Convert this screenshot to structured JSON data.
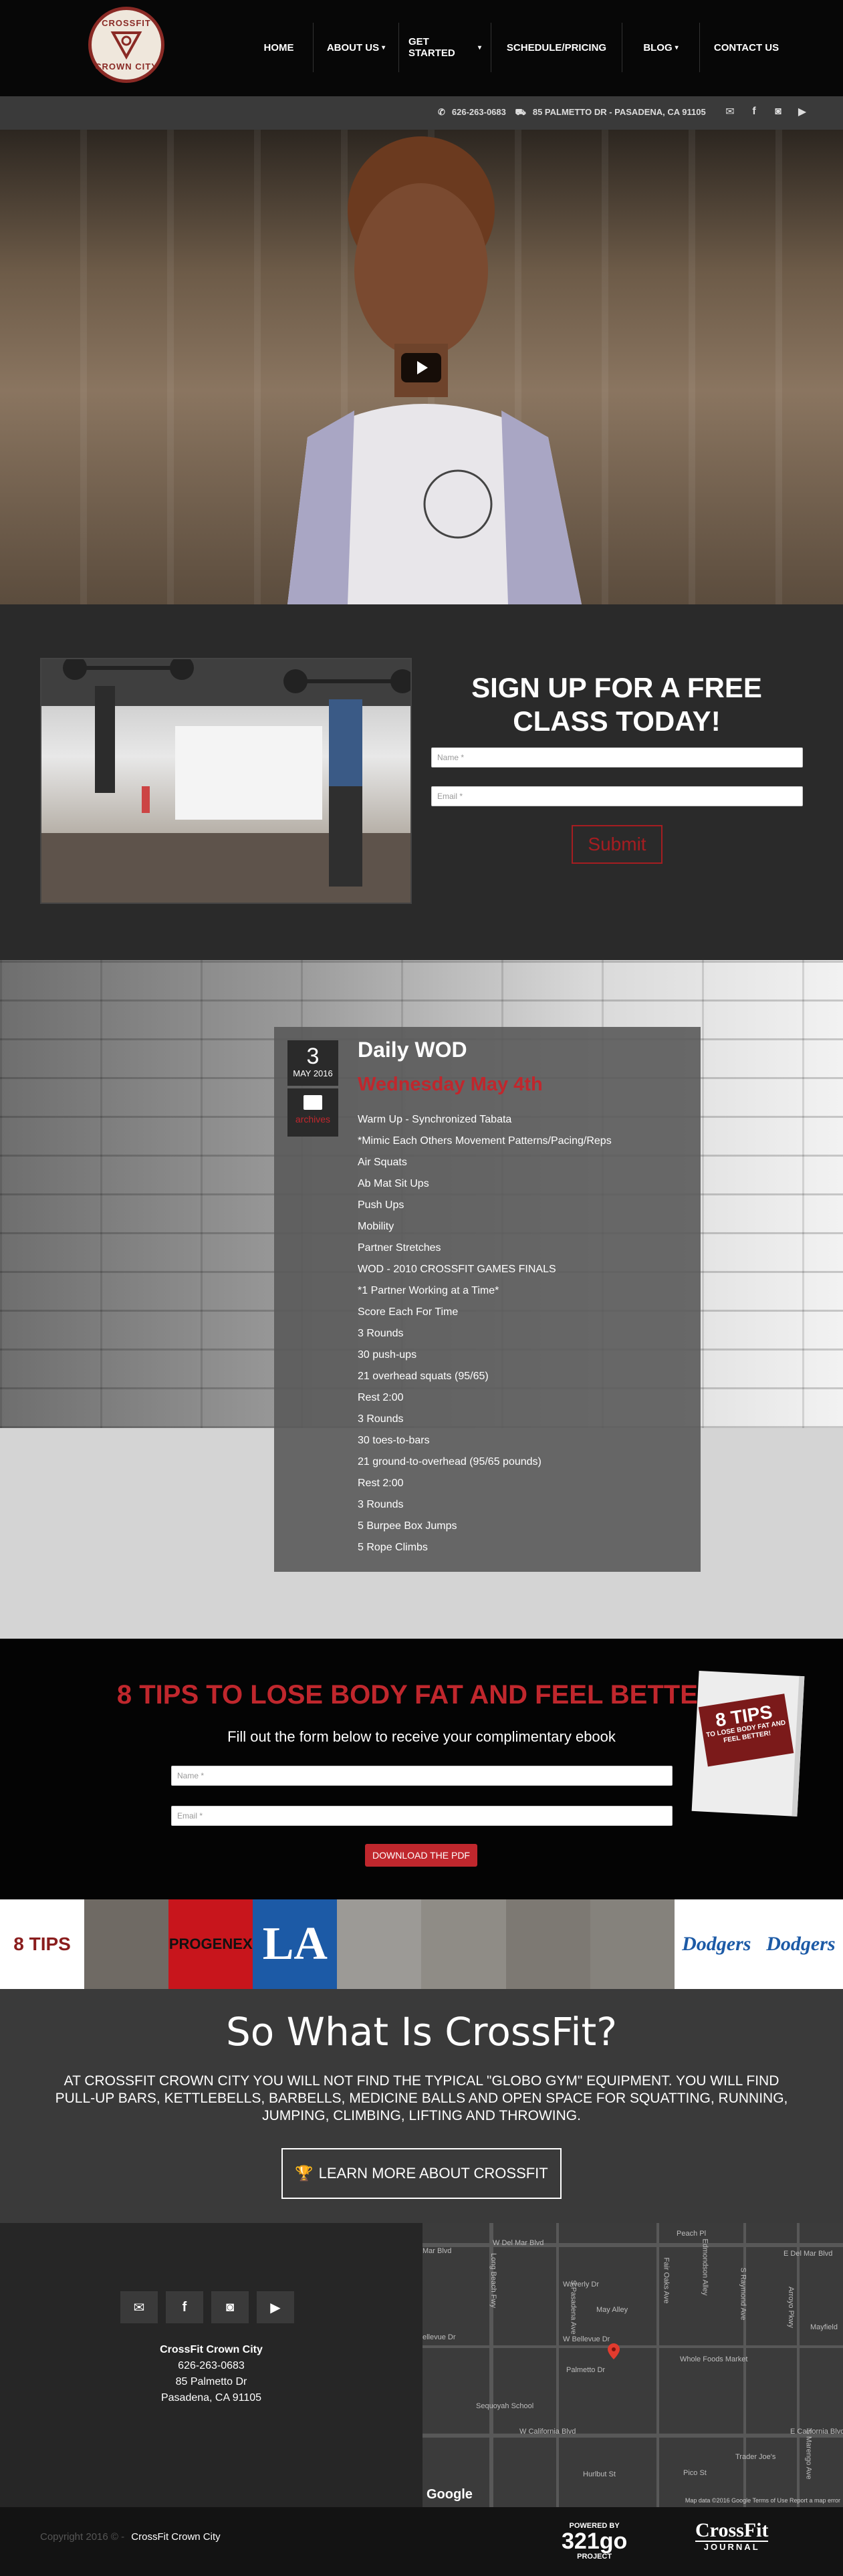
{
  "header": {
    "logo_top": "CROSSFIT",
    "logo_bottom": "CROWN CITY",
    "nav": [
      {
        "label": "HOME",
        "caret": ""
      },
      {
        "label": "ABOUT US",
        "caret": "▾"
      },
      {
        "label": "GET STARTED",
        "caret": "▾"
      },
      {
        "label": "SCHEDULE/PRICING",
        "caret": ""
      },
      {
        "label": "BLOG",
        "caret": "▾"
      },
      {
        "label": "CONTACT US",
        "caret": ""
      }
    ]
  },
  "infobar": {
    "phone": "626-263-0683",
    "address": "85 PALMETTO DR - PASADENA, CA 91105",
    "social": [
      "mail-icon",
      "facebook-icon",
      "instagram-icon",
      "youtube-icon"
    ]
  },
  "signup": {
    "title": "SIGN UP FOR A FREE CLASS TODAY!",
    "name_placeholder": "Name *",
    "email_placeholder": "Email *",
    "submit_label": "Submit"
  },
  "wod": {
    "day": "3",
    "month": "MAY 2016",
    "archive_label": "archives",
    "title": "Daily WOD",
    "subtitle": "Wednesday May 4th",
    "lines": [
      "Warm Up - Synchronized Tabata",
      "*Mimic Each Others Movement Patterns/Pacing/Reps",
      "Air Squats",
      "Ab Mat Sit Ups",
      "Push Ups",
      "Mobility",
      "Partner Stretches",
      "WOD - 2010 CROSSFIT GAMES FINALS",
      "*1 Partner Working at a Time*",
      "Score Each For Time",
      "3 Rounds",
      "30 push-ups",
      "21 overhead squats (95/65)",
      "Rest 2:00",
      "3 Rounds",
      "30 toes-to-bars",
      "21 ground-to-overhead (95/65 pounds)",
      "Rest 2:00",
      "3 Rounds",
      "5 Burpee Box Jumps",
      "5 Rope Climbs"
    ]
  },
  "tips": {
    "title": "8 TIPS TO LOSE BODY FAT AND FEEL BETTER!",
    "subtitle": "Fill out the form below to receive your complimentary ebook",
    "name_placeholder": "Name *",
    "email_placeholder": "Email *",
    "button_label": "DOWNLOAD THE PDF",
    "ebook_big": "8 TIPS",
    "ebook_small": "TO LOSE BODY FAT AND FEEL BETTER!"
  },
  "strip": [
    {
      "label": "8 TIPS",
      "bg": "#ffffff",
      "fg": "#8a1d1d"
    },
    {
      "label": "",
      "bg": "#6f6a64",
      "fg": "#ffffff"
    },
    {
      "label": "PROGENEX",
      "bg": "#c8151c",
      "fg": "#111111"
    },
    {
      "label": "LA",
      "bg": "#1c5aa6",
      "fg": "#ffffff"
    },
    {
      "label": "",
      "bg": "#9c9a96",
      "fg": "#ffffff"
    },
    {
      "label": "",
      "bg": "#8f8c86",
      "fg": "#ffffff"
    },
    {
      "label": "",
      "bg": "#7d7973",
      "fg": "#ffffff"
    },
    {
      "label": "",
      "bg": "#85827c",
      "fg": "#ffffff"
    },
    {
      "label": "Dodgers",
      "bg": "#ffffff",
      "fg": "#1c5aa6"
    },
    {
      "label": "Dodgers",
      "bg": "#ffffff",
      "fg": "#1c5aa6"
    }
  ],
  "whatis": {
    "title": "So What Is CrossFit?",
    "body": "AT CROSSFIT CROWN CITY YOU WILL NOT FIND THE TYPICAL \"GLOBO GYM\" EQUIPMENT. YOU WILL FIND PULL-UP BARS, KETTLEBELLS, BARBELLS, MEDICINE BALLS AND OPEN SPACE FOR SQUATTING, RUNNING, JUMPING, CLIMBING, LIFTING AND THROWING.",
    "button_label": "LEARN MORE ABOUT CROSSFIT"
  },
  "contact": {
    "icons": [
      "mail-icon",
      "facebook-icon",
      "instagram-icon",
      "youtube-icon"
    ],
    "name": "CrossFit Crown City",
    "phone": "626-263-0683",
    "street": "85 Palmetto Dr",
    "city": "Pasadena, CA 91105"
  },
  "map": {
    "labels": [
      "Peach Pl",
      "W Del Mar Blvd",
      "E Del Mar Blvd",
      "Waverly Dr",
      "May Alley",
      "W Bellevue Dr",
      "Palmetto Dr",
      "Whole Foods Market",
      "Sequoyah School",
      "W California Blvd",
      "E California Blvd",
      "Trader Joe's",
      "Pico St",
      "Mar Blvd",
      "ellevue Dr",
      "Mayfield",
      "S Pasadena Ave",
      "Long Beach Fwy",
      "Fair Oaks Ave",
      "S Raymond Ave",
      "Arroyo Pkwy",
      "S Marengo Ave",
      "Edmondson Alley",
      "Hurlbut St"
    ],
    "google": "Google",
    "footer": "Map data ©2016 Google   Terms of Use   Report a map error"
  },
  "bottom": {
    "copyright": "Copyright 2016 © -",
    "owner": "CrossFit Crown City",
    "powered_by": "POWERED BY",
    "powered_num": "321go",
    "powered_sub": "PROJECT",
    "cf_top": "CrossFit",
    "cf_bottom": "JOURNAL"
  },
  "colors": {
    "accent_red": "#c0272d",
    "dark": "#2a2a2a"
  }
}
